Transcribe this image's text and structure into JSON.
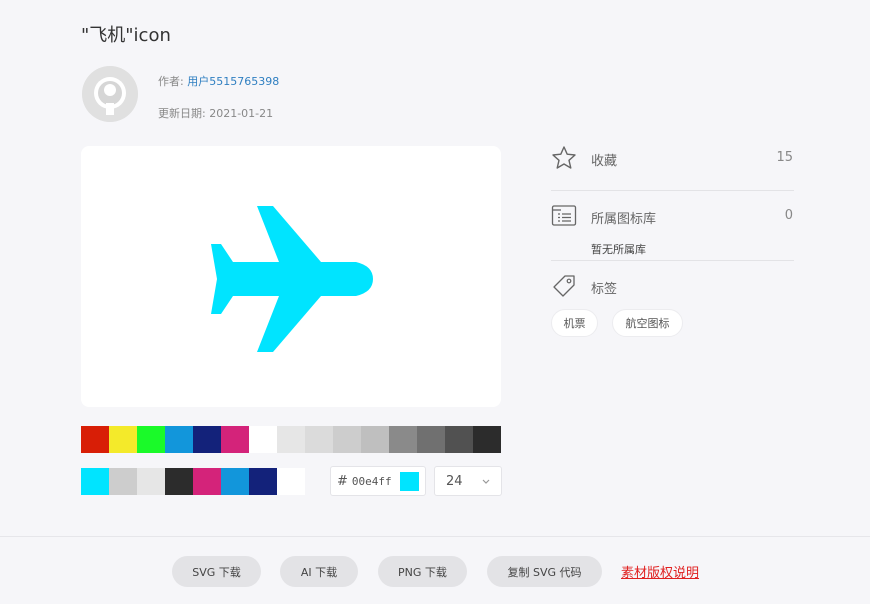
{
  "header": {
    "title": "\"飞机\"icon",
    "author_label": "作者:",
    "author_name": "用户5515765398",
    "date_label": "更新日期:",
    "date_value": "2021-01-21"
  },
  "icon": {
    "name": "airplane-icon",
    "color": "#00e4ff"
  },
  "palette": {
    "row1": [
      "#d81e06",
      "#f4ea2a",
      "#1afa29",
      "#1296db",
      "#13227a",
      "#d4237a",
      "#ffffff",
      "#e6e6e6",
      "#dbdbdb",
      "#cdcdcd",
      "#bfbfbf",
      "#8a8a8a",
      "#707070",
      "#515151",
      "#2c2c2c"
    ],
    "row2": [
      "#00e4ff",
      "#cdcdcd",
      "#e6e6e6",
      "#2c2c2c",
      "#d4237a",
      "#1296db",
      "#13227a",
      "#ffffff"
    ]
  },
  "color_input": {
    "hash": "#",
    "value": "00e4ff"
  },
  "size_select": {
    "value": "24"
  },
  "sidebar": {
    "favorites_label": "收藏",
    "favorites_count": "15",
    "library_label": "所属图标库",
    "library_count": "0",
    "library_none": "暂无所属库",
    "tags_label": "标签",
    "tags": [
      "机票",
      "航空图标"
    ]
  },
  "footer": {
    "svg_download": "SVG 下载",
    "ai_download": "AI 下载",
    "png_download": "PNG 下载",
    "copy_svg": "复制 SVG 代码",
    "license": "素材版权说明"
  }
}
